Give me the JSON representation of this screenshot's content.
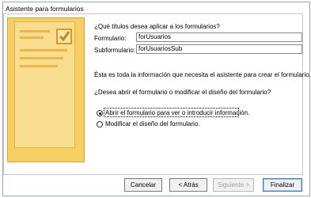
{
  "window": {
    "title": "Asistente para formularios"
  },
  "question_titles": "¿Qué títulos desea aplicar a los formularios?",
  "form_label": "Formulario:",
  "form_value": "forUsuarios",
  "subform_label": "Subformulario:",
  "subform_value": "forUsuariosSub",
  "info_text": "Ésta es toda la información que necesita el asistente para crear el formulario.",
  "question_open": "¿Desea abrir el formulario o modificar el diseño del formulario?",
  "options": [
    {
      "label": "Abrir el formulario para ver o introducir información.",
      "selected": true
    },
    {
      "label": "Modificar el diseño del formulario.",
      "selected": false
    }
  ],
  "buttons": {
    "cancel": "Cancelar",
    "back": "< Atrás",
    "next": "Siguiente >",
    "finish": "Finalizar"
  },
  "colors": {
    "art_fill": "#f6cf63",
    "art_border": "#cfa640",
    "accent": "#3c7fb1"
  }
}
